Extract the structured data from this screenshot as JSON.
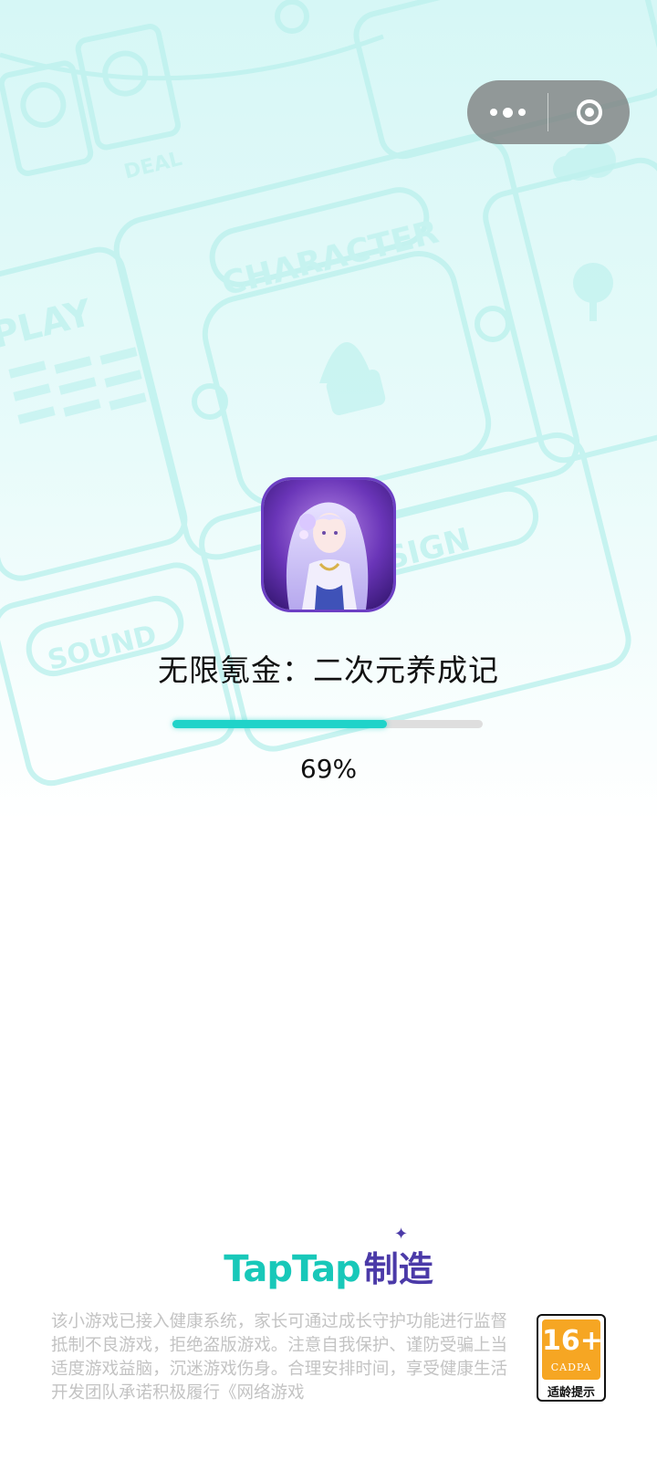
{
  "background": {
    "card_words": [
      "CHARACTER",
      "PLAY",
      "DESIGN",
      "SOUND",
      "DEAL"
    ]
  },
  "capsule": {
    "more_icon": "more-dots-icon",
    "close_icon": "close-target-icon"
  },
  "game": {
    "title": "无限氪金：二次元养成记",
    "icon": "game-cover-anime-girl"
  },
  "progress": {
    "value": 0.69,
    "label": "69%",
    "fill_color": "#1fd3c9"
  },
  "brand": {
    "name_latin": "TapTap",
    "name_cn": "制造"
  },
  "notice": "该小游戏已接入健康系统，家长可通过成长守护功能进行监督抵制不良游戏，拒绝盗版游戏。注意自我保护、谨防受骗上当适度游戏益脑，沉迷游戏伤身。合理安排时间，享受健康生活开发团队承诺积极履行《网络游戏",
  "age_rating": {
    "rating": "16+",
    "org": "CADPA",
    "label": "适龄提示"
  }
}
